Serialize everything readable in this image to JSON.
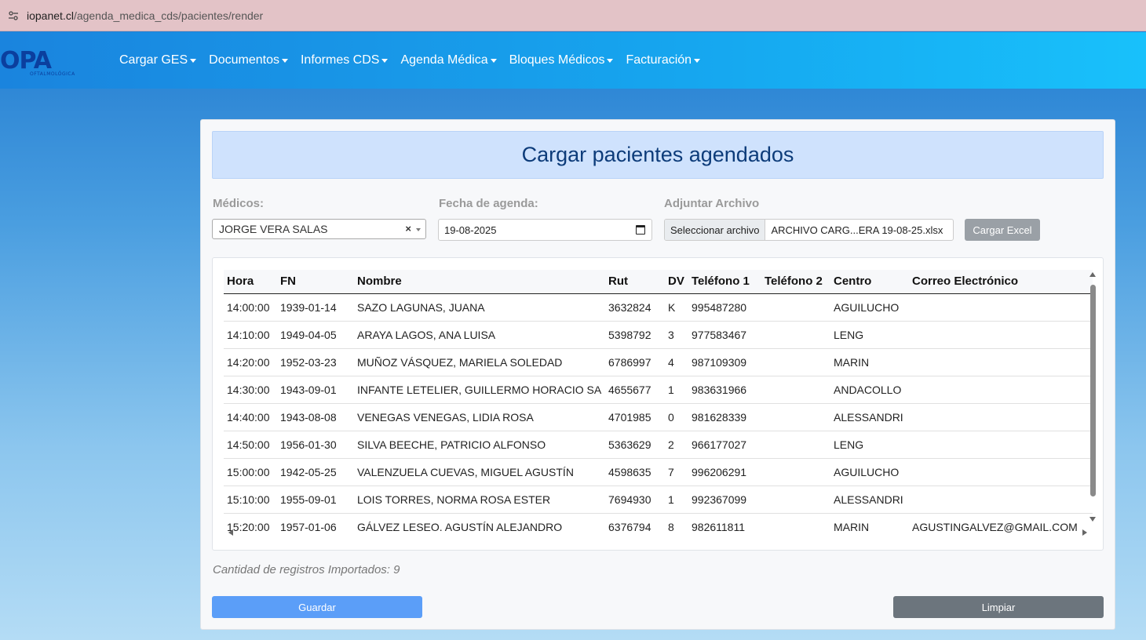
{
  "browser": {
    "url_domain": "iopanet.cl",
    "url_path": "/agenda_medica_cds/pacientes/render"
  },
  "logo": {
    "text": "OPA",
    "subtitle": "OFTALMOLÓGICA"
  },
  "nav": {
    "items": [
      {
        "label": "Cargar GES"
      },
      {
        "label": "Documentos"
      },
      {
        "label": "Informes CDS"
      },
      {
        "label": "Agenda Médica"
      },
      {
        "label": "Bloques Médicos"
      },
      {
        "label": "Facturación"
      }
    ]
  },
  "main": {
    "title": "Cargar pacientes agendados",
    "medicos_label": "Médicos:",
    "medicos_value": "JORGE VERA SALAS",
    "fecha_label": "Fecha de agenda:",
    "fecha_value": "19-08-2025",
    "archivo_label": "Adjuntar Archivo",
    "archivo_button": "Seleccionar archivo",
    "archivo_name": "ARCHIVO CARG...ERA 19-08-25.xlsx",
    "excel_button": "Cargar Excel",
    "count_text": "Cantidad de registros Importados: 9",
    "save_button": "Guardar",
    "clear_button": "Limpiar"
  },
  "table": {
    "headers": [
      "Hora",
      "FN",
      "Nombre",
      "Rut",
      "DV",
      "Teléfono 1",
      "Teléfono 2",
      "Centro",
      "Correo Electrónico"
    ],
    "rows": [
      [
        "14:00:00",
        "1939-01-14",
        "SAZO LAGUNAS, JUANA",
        "3632824",
        "K",
        "995487280",
        "",
        "AGUILUCHO",
        ""
      ],
      [
        "14:10:00",
        "1949-04-05",
        "ARAYA LAGOS, ANA LUISA",
        "5398792",
        "3",
        "977583467",
        "",
        "LENG",
        ""
      ],
      [
        "14:20:00",
        "1952-03-23",
        "MUÑOZ VÁSQUEZ, MARIELA SOLEDAD",
        "6786997",
        "4",
        "987109309",
        "",
        "MARIN",
        ""
      ],
      [
        "14:30:00",
        "1943-09-01",
        "INFANTE LETELIER, GUILLERMO HORACIO SA",
        "4655677",
        "1",
        "983631966",
        "",
        "ANDACOLLO",
        ""
      ],
      [
        "14:40:00",
        "1943-08-08",
        "VENEGAS VENEGAS, LIDIA ROSA",
        "4701985",
        "0",
        "981628339",
        "",
        "ALESSANDRI",
        ""
      ],
      [
        "14:50:00",
        "1956-01-30",
        "SILVA BEECHE, PATRICIO ALFONSO",
        "5363629",
        "2",
        "966177027",
        "",
        "LENG",
        ""
      ],
      [
        "15:00:00",
        "1942-05-25",
        "VALENZUELA CUEVAS, MIGUEL AGUSTÍN",
        "4598635",
        "7",
        "996206291",
        "",
        "AGUILUCHO",
        ""
      ],
      [
        "15:10:00",
        "1955-09-01",
        "LOIS TORRES, NORMA ROSA ESTER",
        "7694930",
        "1",
        "992367099",
        "",
        "ALESSANDRI",
        ""
      ],
      [
        "15:20:00",
        "1957-01-06",
        "GÁLVEZ LESEO. AGUSTÍN ALEJANDRO",
        "6376794",
        "8",
        "982611811",
        "",
        "MARIN",
        "AGUSTINGALVEZ@GMAIL.COM"
      ]
    ]
  },
  "colors": {
    "navbar_start": "#1a84de",
    "navbar_end": "#18c1fb",
    "title_bg": "#cfe2fd",
    "save_button": "#5b9ef8",
    "clear_button": "#6c757d"
  }
}
